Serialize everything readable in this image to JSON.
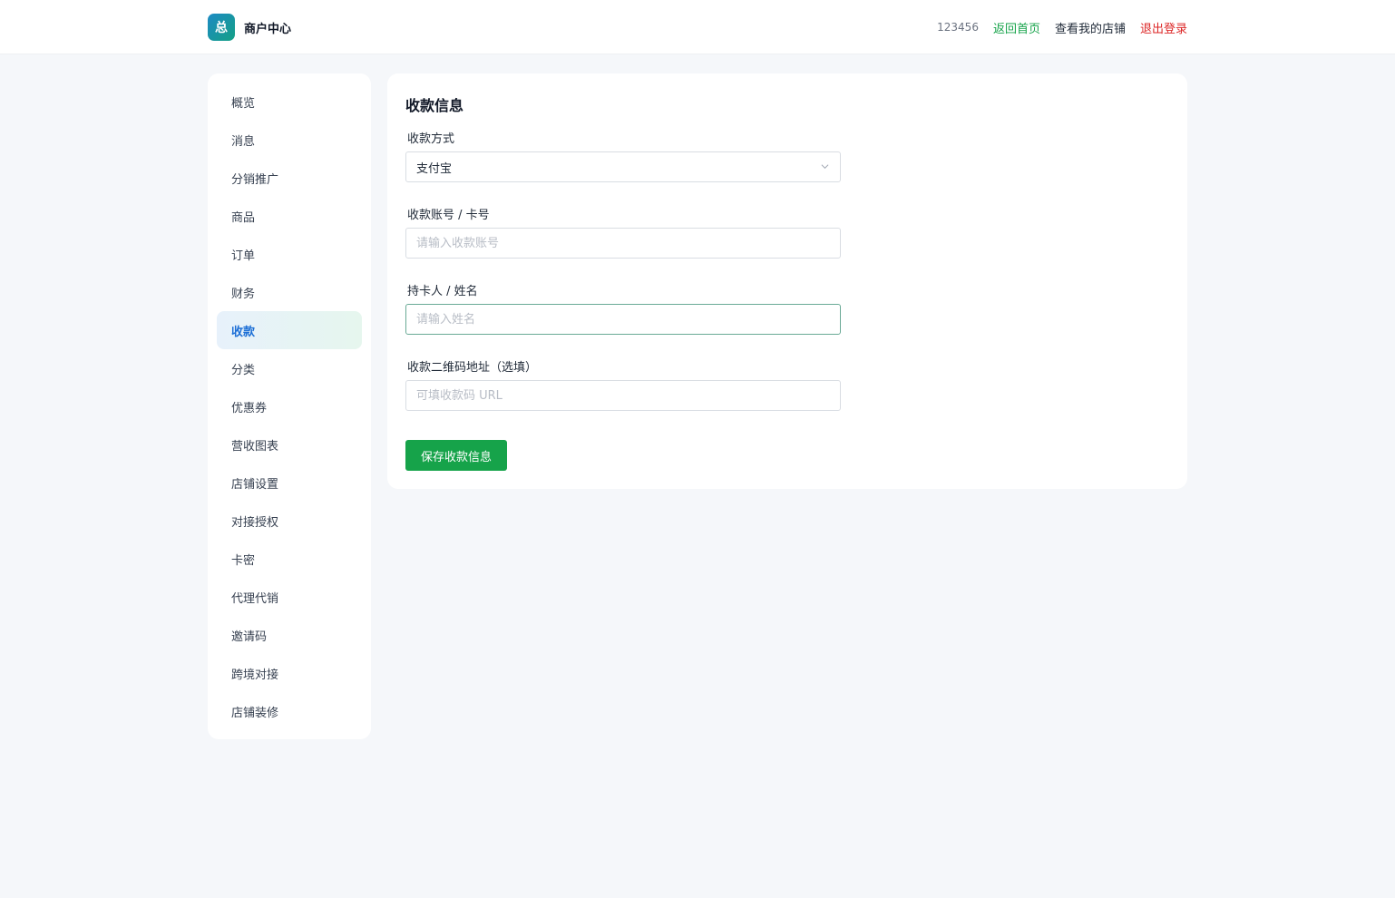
{
  "header": {
    "logo_char": "总",
    "title": "商户中心",
    "user_id": "123456",
    "home_link": "返回首页",
    "shop_link": "查看我的店铺",
    "logout_link": "退出登录"
  },
  "sidebar": {
    "items": [
      {
        "label": "概览"
      },
      {
        "label": "消息"
      },
      {
        "label": "分销推广"
      },
      {
        "label": "商品"
      },
      {
        "label": "订单"
      },
      {
        "label": "财务"
      },
      {
        "label": "收款",
        "active": true
      },
      {
        "label": "分类"
      },
      {
        "label": "优惠券"
      },
      {
        "label": "营收图表"
      },
      {
        "label": "店铺设置"
      },
      {
        "label": "对接授权"
      },
      {
        "label": "卡密"
      },
      {
        "label": "代理代销"
      },
      {
        "label": "邀请码"
      },
      {
        "label": "跨境对接"
      },
      {
        "label": "店铺装修"
      }
    ]
  },
  "form": {
    "title": "收款信息",
    "method": {
      "label": "收款方式",
      "value": "支付宝"
    },
    "account": {
      "label": "收款账号 / 卡号",
      "placeholder": "请输入收款账号",
      "value": ""
    },
    "holder": {
      "label": "持卡人 / 姓名",
      "placeholder": "请输入姓名",
      "value": ""
    },
    "qrcode": {
      "label": "收款二维码地址（选填）",
      "placeholder": "可填收款码 URL",
      "value": ""
    },
    "save_label": "保存收款信息"
  },
  "colors": {
    "primary_green": "#16a34a",
    "active_nav_text": "#1d6fd6",
    "logout_red": "#dc2626",
    "background": "#f5f7fa"
  }
}
